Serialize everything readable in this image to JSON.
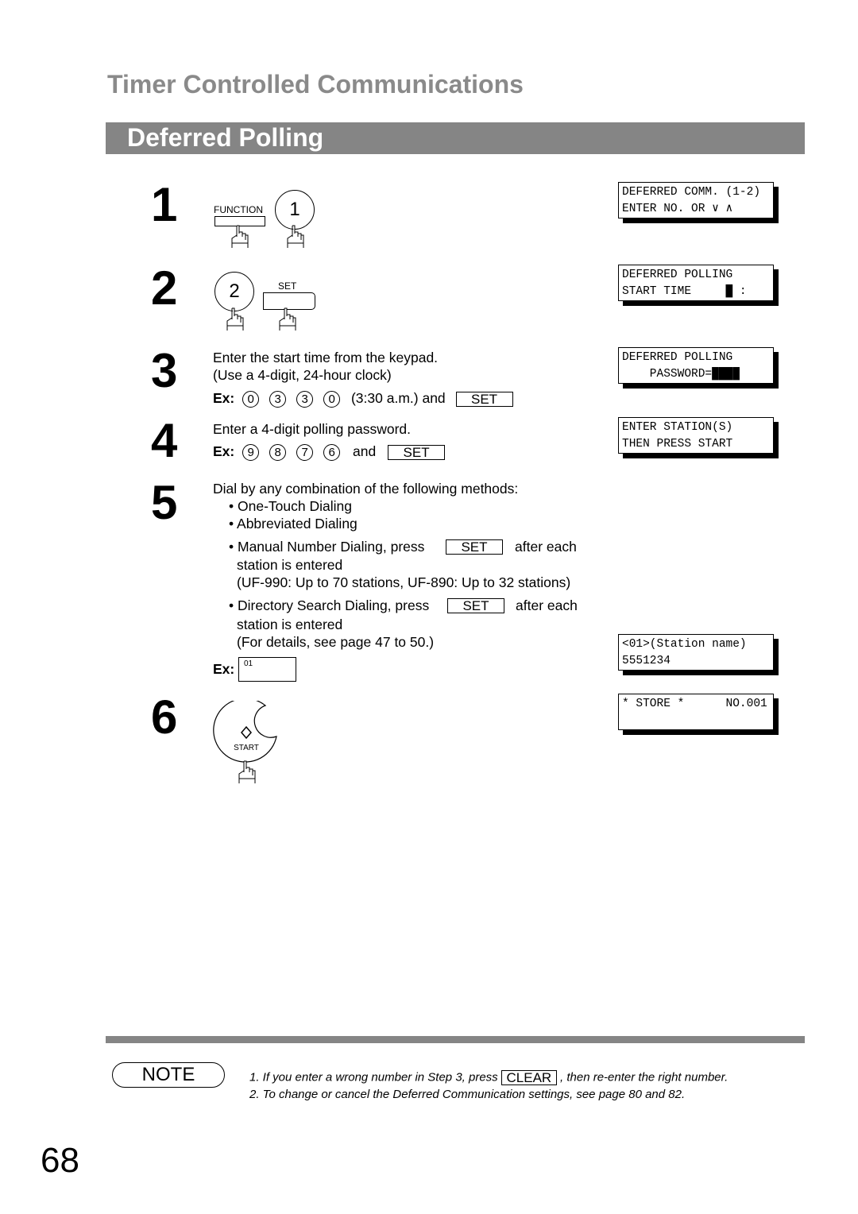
{
  "header": {
    "section_title": "Timer Controlled Communications",
    "subsection_title": "Deferred Polling"
  },
  "steps": [
    {
      "number": "1",
      "keys": [
        "FUNCTION",
        "1"
      ]
    },
    {
      "number": "2",
      "keys": [
        "2",
        "SET"
      ]
    },
    {
      "number": "3",
      "line1": "Enter the start time from the keypad.",
      "line2": "(Use a 4-digit, 24-hour clock)",
      "ex_label": "Ex:",
      "digits": [
        "0",
        "3",
        "3",
        "0"
      ],
      "suffix": "(3:30 a.m.) and",
      "key": "SET"
    },
    {
      "number": "4",
      "line1": "Enter a 4-digit polling password.",
      "ex_label": "Ex:",
      "digits": [
        "9",
        "8",
        "7",
        "6"
      ],
      "suffix": "and",
      "key": "SET"
    },
    {
      "number": "5",
      "line1": "Dial by any combination of the following methods:",
      "bullets": [
        "One-Touch Dialing",
        "Abbreviated Dialing"
      ],
      "manual": {
        "text": "Manual Number Dialing, press",
        "key": "SET",
        "after": "after each",
        "line2": "station is entered",
        "line3": "(UF-990: Up to 70 stations, UF-890: Up to 32 stations)"
      },
      "directory": {
        "text": "Directory Search Dialing, press",
        "key": "SET",
        "after": "after each",
        "line2": "station is entered",
        "line3": "(For details, see page 47 to 50.)"
      },
      "ex_label": "Ex:",
      "ex_key": "01"
    },
    {
      "number": "6",
      "key": "START"
    }
  ],
  "displays": [
    {
      "line1": "DEFERRED COMM. (1-2)",
      "line2": "ENTER NO. OR ∨ ∧"
    },
    {
      "line1": "DEFERRED POLLING",
      "line2": "START TIME     █ :"
    },
    {
      "line1": "DEFERRED POLLING",
      "line2": "    PASSWORD=████"
    },
    {
      "line1": "ENTER STATION(S)",
      "line2": "THEN PRESS START"
    },
    {
      "line1": "<01>(Station name)",
      "line2": "5551234"
    },
    {
      "line1": "* STORE *      NO.001",
      "line2": ""
    }
  ],
  "note": {
    "label": "NOTE",
    "items": [
      {
        "pre": "1.  If you enter a wrong number in Step 3, press",
        "key": "CLEAR",
        "post": ", then re-enter the right number."
      },
      {
        "pre": "2.  To change or cancel the Deferred Communication settings, see page 80 and 82."
      }
    ]
  },
  "page_number": "68"
}
